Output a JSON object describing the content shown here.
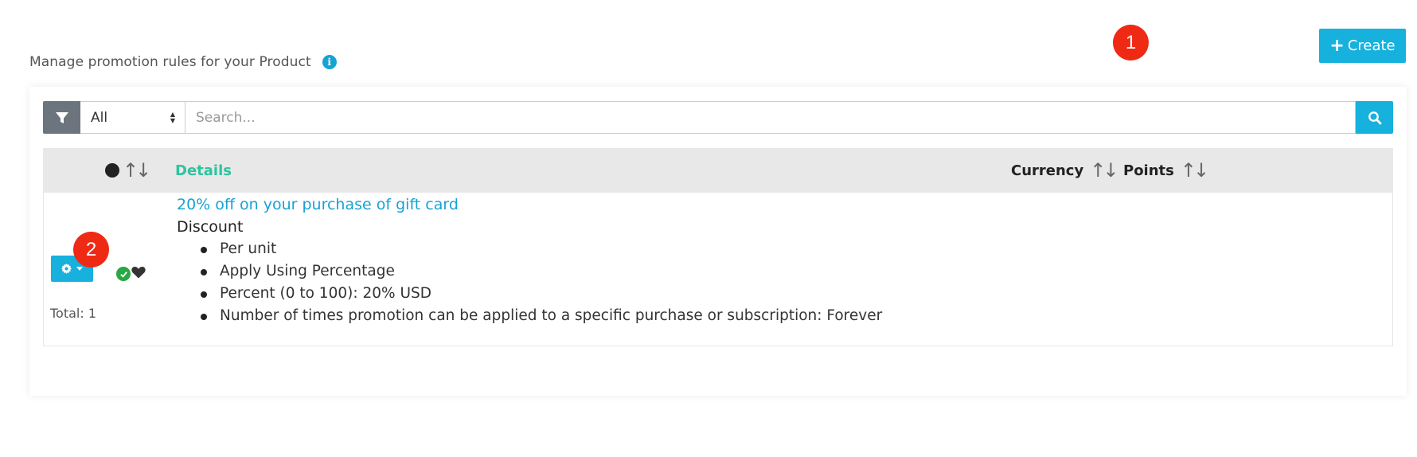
{
  "header": {
    "description": "Manage promotion rules for your Product",
    "create_label": "Create",
    "badge_1": "1",
    "badge_2": "2"
  },
  "filter": {
    "selected": "All",
    "search_placeholder": "Search..."
  },
  "table": {
    "columns": {
      "details": "Details",
      "currency": "Currency",
      "points": "Points"
    },
    "rows": [
      {
        "title": "20% off on your purchase of gift card",
        "type": "Discount",
        "items": [
          "Per unit",
          "Apply Using Percentage",
          "Percent (0 to 100): 20% USD",
          "Number of times promotion can be applied to a specific purchase or subscription: Forever"
        ],
        "currency": "",
        "points": ""
      }
    ],
    "total": "Total: 1"
  },
  "colors": {
    "accent": "#17b1dd",
    "details_header": "#2fc39f",
    "badge": "#ee2a14",
    "active_check": "#28a745",
    "filter_button": "#6c757d"
  },
  "icons": [
    "info-icon",
    "plus-icon",
    "filter-icon",
    "search-icon",
    "gear-icon",
    "caret-down-icon",
    "check-circle-icon",
    "heart-icon",
    "sort-icon"
  ]
}
